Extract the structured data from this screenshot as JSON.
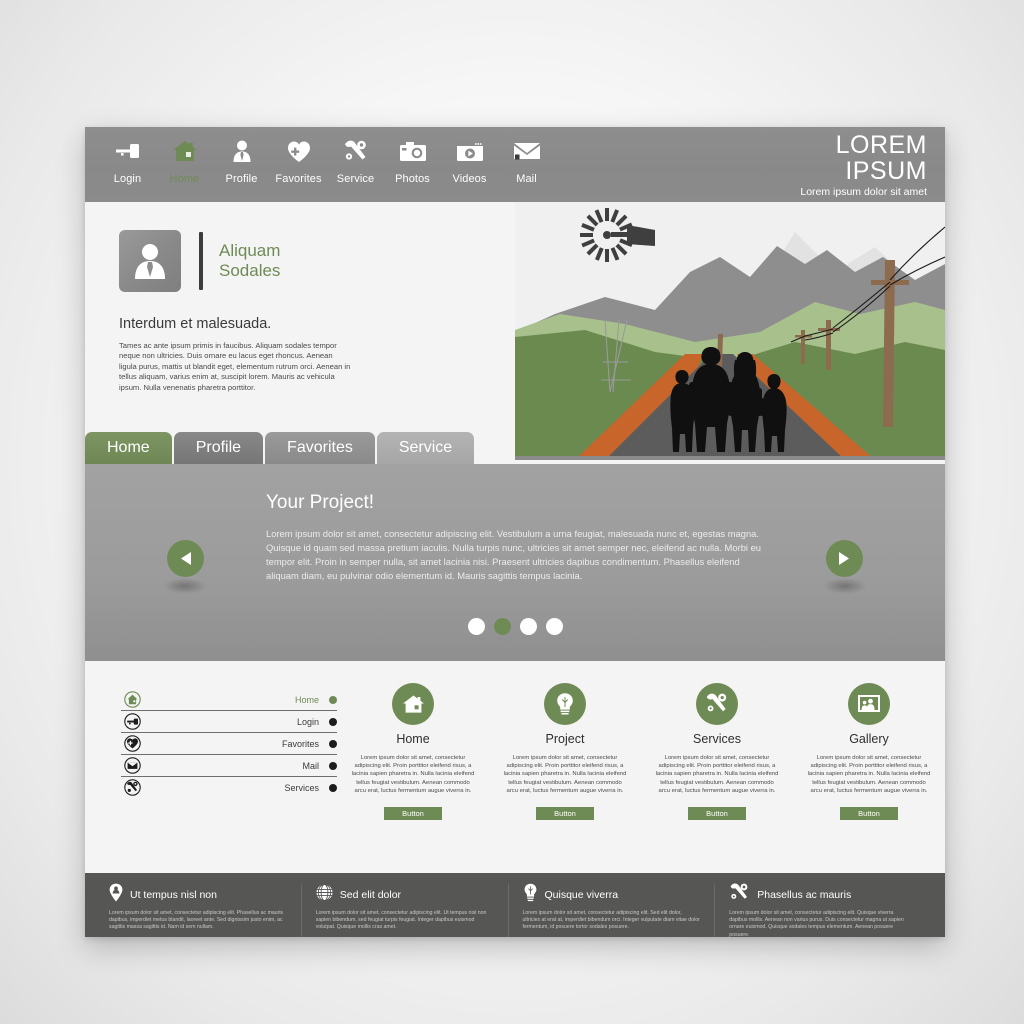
{
  "header": {
    "nav": [
      {
        "label": "Login",
        "icon": "key-icon",
        "active": false
      },
      {
        "label": "Home",
        "icon": "house-icon",
        "active": true
      },
      {
        "label": "Profile",
        "icon": "user-icon",
        "active": false
      },
      {
        "label": "Favorites",
        "icon": "heart-plus-icon",
        "active": false
      },
      {
        "label": "Service",
        "icon": "wrench-gear-icon",
        "active": false
      },
      {
        "label": "Photos",
        "icon": "camera-icon",
        "active": false
      },
      {
        "label": "Videos",
        "icon": "video-player-icon",
        "active": false
      },
      {
        "label": "Mail",
        "icon": "envelope-icon",
        "active": false
      }
    ],
    "brand_line1": "LOREM",
    "brand_line2": "IPSUM",
    "brand_tagline": "Lorem ipsum dolor sit amet"
  },
  "intro": {
    "name_line1": "Aliquam",
    "name_line2": "Sodales",
    "heading": "Interdum et malesuada.",
    "body": "Tames ac ante ipsum primis in faucibus. Aliquam sodales tempor neque non ultricies. Duis ornare eu lacus eget rhoncus. Aenean ligula purus, mattis ut blandit eget, elementum rutrum orci. Aenean in tellus aliquam, varius enim at, suscipit lorem. Mauris ac vehicula ipsum. Nulla venenatis pharetra porttitor."
  },
  "tabs": [
    {
      "label": "Home",
      "active": true
    },
    {
      "label": "Profile",
      "active": false
    },
    {
      "label": "Favorites",
      "active": false
    },
    {
      "label": "Service",
      "active": false
    }
  ],
  "slider": {
    "title": "Your Project!",
    "body": "Lorem ipsum dolor sit amet, consectetur adipiscing elit. Vestibulum a urna feugiat, malesuada nunc et, egestas magna. Quisque id quam sed massa pretium iaculis. Nulla turpis nunc, ultricies sit amet semper nec, eleifend ac nulla. Morbi eu tempor elit. Proin in semper nulla, sit amet lacinia nisi. Praesent ultricies dapibus condimentum. Phasellus eleifend aliquam diam, eu pulvinar odio elementum id. Mauris sagittis tempus lacinia.",
    "prev_label": "◀",
    "next_label": "▶",
    "dots": [
      {
        "active": false
      },
      {
        "active": true
      },
      {
        "active": false
      },
      {
        "active": false
      }
    ]
  },
  "sidemenu": [
    {
      "label": "Home",
      "icon": "house-circle-icon",
      "active": true
    },
    {
      "label": "Login",
      "icon": "key-circle-icon",
      "active": false
    },
    {
      "label": "Favorites",
      "icon": "heart-plus-circle-icon",
      "active": false
    },
    {
      "label": "Mail",
      "icon": "envelope-circle-icon",
      "active": false
    },
    {
      "label": "Services",
      "icon": "wrench-gear-circle-icon",
      "active": false
    }
  ],
  "features": [
    {
      "title": "Home",
      "icon": "house-icon",
      "body": "Lorem ipsum dolor sit amet, consectetur adipiscing elit. Proin porttitor eleifend risus, a lacinia sapien pharetra in. Nulla lacinia eleifend tellus feugiat vestibulum. Aenean commodo arcu erat, luctus fermentum augue viverra in.",
      "button": "Button"
    },
    {
      "title": "Project",
      "icon": "lightbulb-icon",
      "body": "Lorem ipsum dolor sit amet, consectetur adipiscing elit. Proin porttitor eleifend risus, a lacinia sapien pharetra in. Nulla lacinia eleifend tellus feugiat vestibulum. Aenean commodo arcu erat, luctus fermentum augue viverra in.",
      "button": "Button"
    },
    {
      "title": "Services",
      "icon": "wrench-gear-icon",
      "body": "Lorem ipsum dolor sit amet, consectetur adipiscing elit. Proin porttitor eleifend risus, a lacinia sapien pharetra in. Nulla lacinia eleifend tellus feugiat vestibulum. Aenean commodo arcu erat, luctus fermentum augue viverra in.",
      "button": "Button"
    },
    {
      "title": "Gallery",
      "icon": "picture-frame-icon",
      "body": "Lorem ipsum dolor sit amet, consectetur adipiscing elit. Proin porttitor eleifend risus, a lacinia sapien pharetra in. Nulla lacinia eleifend tellus feugiat vestibulum. Aenean commodo arcu erat, luctus fermentum augue viverra in.",
      "button": "Button"
    }
  ],
  "footer": [
    {
      "title": "Ut tempus nisl non",
      "icon": "map-pin-user-icon",
      "body": "Lorem ipsum dolor sit amet, consectetur adipiscing elit. Phasellus ac mauris dapibus, imperdiet metus blandit, laoreet ante. Sed dignissim justo enim, ac sagittis massa sagittis id. Nam id sem nullam."
    },
    {
      "title": "Sed elit dolor",
      "icon": "globe-icon",
      "body": "Lorem ipsum dolor sit amet, consectetur adipiscing elit. Ut tempus nisl non sapien bibendum, sed feugiat turpis feugiat. Integer dapibus euismod volutpat. Quisque mollis cras amet."
    },
    {
      "title": "Quisque viverra",
      "icon": "lightbulb-icon",
      "body": "Lorem ipsum dolor sit amet, consectetur adipiscing elit. Sed elit dolor, ultricies at erat at, imperdiet bibendum orci. Integer vulputate diam vitae dolor fermentum, id posuere tortor sodales posuere."
    },
    {
      "title": "Phasellus ac mauris",
      "icon": "wrench-gear-icon",
      "body": "Lorem ipsum dolor sit amet, consectetur adipiscing elit. Quisque viverra dapibus mollis. Aenean non varius purus. Duis consectetur magna ut sapien ornare euismod. Quisque sodales tempus elementum. Aenean posuere posuere."
    }
  ],
  "colors": {
    "accent_green": "#6f8b55",
    "header_gray": "#8b8b8b",
    "slider_gray": "#9b9b9b",
    "footer_gray": "#565655",
    "page_bg": "#f4f4f4"
  }
}
